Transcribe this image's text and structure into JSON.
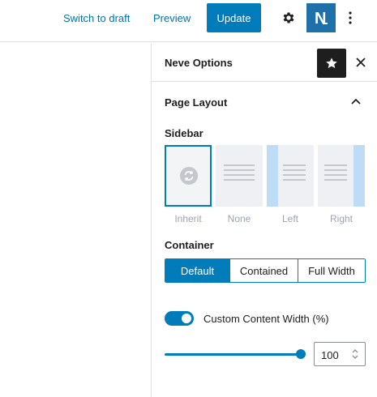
{
  "topbar": {
    "switch_to_draft": "Switch to draft",
    "preview": "Preview",
    "update": "Update",
    "logo_letter": "N",
    "accent": "#007cba"
  },
  "panel": {
    "title": "Neve Options",
    "section": {
      "title": "Page Layout",
      "expanded": true
    },
    "sidebar": {
      "label": "Sidebar",
      "options": [
        {
          "label": "Inherit",
          "selected": true
        },
        {
          "label": "None",
          "selected": false
        },
        {
          "label": "Left",
          "selected": false
        },
        {
          "label": "Right",
          "selected": false
        }
      ]
    },
    "container": {
      "label": "Container",
      "options": [
        {
          "label": "Default",
          "active": true
        },
        {
          "label": "Contained",
          "active": false
        },
        {
          "label": "Full Width",
          "active": false
        }
      ]
    },
    "custom_width": {
      "label": "Custom Content Width (%)",
      "enabled": true,
      "value": "100",
      "slider_fraction": 1.0
    }
  }
}
